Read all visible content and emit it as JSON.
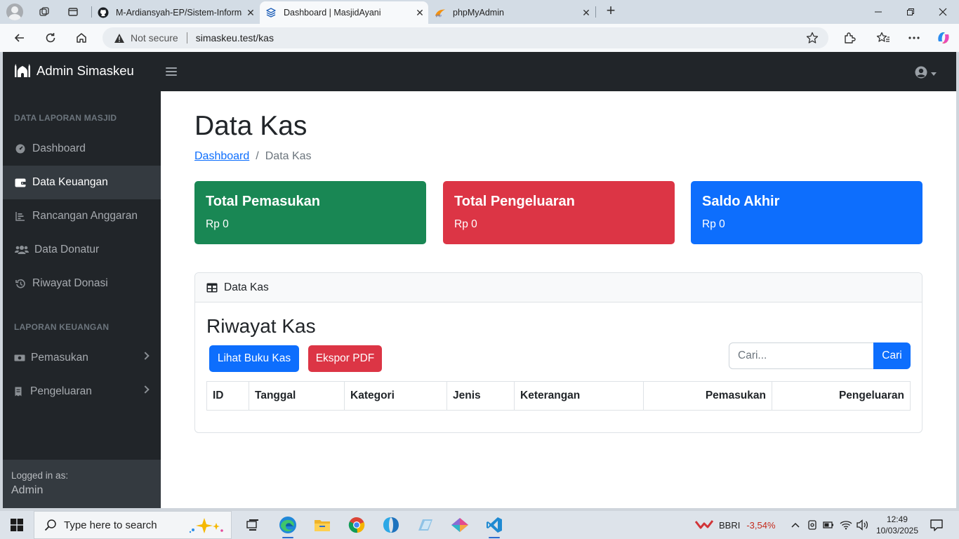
{
  "browser": {
    "tabs": [
      {
        "title": "M-Ardiansyah-EP/Sistem-Informa",
        "favicon": "github-icon",
        "active": false
      },
      {
        "title": "Dashboard | MasjidAyani",
        "favicon": "layers-icon",
        "active": true
      },
      {
        "title": "phpMyAdmin",
        "favicon": "phpmyadmin-icon",
        "active": false
      }
    ],
    "close_glyph": "✕",
    "new_tab_glyph": "+",
    "security_label": "Not secure",
    "url": "simaskeu.test/kas"
  },
  "app": {
    "brand": "Admin Simaskeu",
    "sidebar": {
      "sections": [
        {
          "heading": "DATA LAPORAN MASJID",
          "items": [
            {
              "label": "Dashboard",
              "icon": "gauge-icon"
            },
            {
              "label": "Data Keuangan",
              "icon": "wallet-icon",
              "active": true
            },
            {
              "label": "Rancangan Anggaran",
              "icon": "bar-chart-icon"
            },
            {
              "label": "Data Donatur",
              "icon": "users-icon"
            },
            {
              "label": "Riwayat Donasi",
              "icon": "history-icon"
            }
          ]
        },
        {
          "heading": "LAPORAN KEUANGAN",
          "items": [
            {
              "label": "Pemasukan",
              "icon": "money-icon",
              "expandable": true
            },
            {
              "label": "Pengeluaran",
              "icon": "receipt-icon",
              "expandable": true
            }
          ]
        }
      ],
      "footer": {
        "label": "Logged in as:",
        "user": "Admin"
      }
    },
    "page": {
      "title": "Data Kas",
      "breadcrumb": [
        "Dashboard",
        "/",
        "Data Kas"
      ],
      "cards": [
        {
          "title": "Total Pemasukan",
          "value": "Rp 0",
          "color": "#198754"
        },
        {
          "title": "Total Pengeluaran",
          "value": "Rp 0",
          "color": "#dc3545"
        },
        {
          "title": "Saldo Akhir",
          "value": "Rp 0",
          "color": "#0d6efd"
        }
      ],
      "panel": {
        "header": "Data Kas",
        "section_title": "Riwayat Kas",
        "buttons": [
          {
            "label": "Lihat Buku Kas",
            "color": "#0d6efd"
          },
          {
            "label": "Ekspor PDF",
            "color": "#dc3545"
          }
        ],
        "search_placeholder": "Cari...",
        "search_button": "Cari",
        "columns": [
          "ID",
          "Tanggal",
          "Kategori",
          "Jenis",
          "Keterangan",
          "Pemasukan",
          "Pengeluaran"
        ]
      }
    }
  },
  "taskbar": {
    "search_placeholder": "Type here to search",
    "stock": {
      "ticker": "BBRI",
      "change": "-3,54%"
    },
    "time": "12:49",
    "date": "10/03/2025"
  }
}
